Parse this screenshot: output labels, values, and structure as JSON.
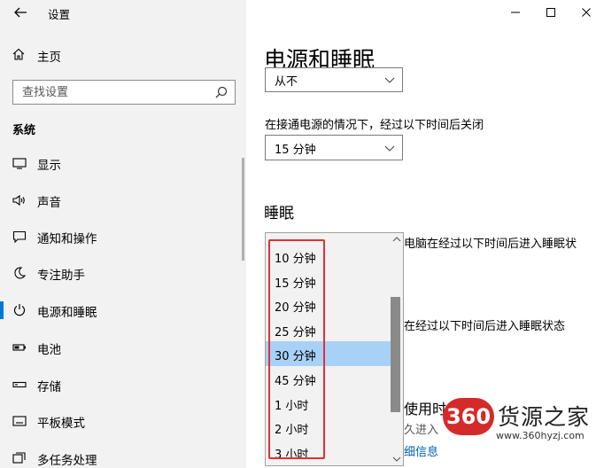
{
  "window": {
    "app_title": "设置",
    "controls": [
      "minimize-icon",
      "maximize-icon",
      "close-icon"
    ]
  },
  "sidebar": {
    "home_label": "主页",
    "search_placeholder": "查找设置",
    "section_title": "系统",
    "items": [
      {
        "label": "显示",
        "icon": "display-icon"
      },
      {
        "label": "声音",
        "icon": "speaker-icon"
      },
      {
        "label": "通知和操作",
        "icon": "notification-icon"
      },
      {
        "label": "专注助手",
        "icon": "moon-icon"
      },
      {
        "label": "电源和睡眠",
        "icon": "power-icon",
        "active": true
      },
      {
        "label": "电池",
        "icon": "battery-icon"
      },
      {
        "label": "存储",
        "icon": "storage-icon"
      },
      {
        "label": "平板模式",
        "icon": "tablet-icon"
      },
      {
        "label": "多任务处理",
        "icon": "multitask-icon"
      }
    ]
  },
  "main": {
    "page_title": "电源和睡眠",
    "screen_battery_value": "从不",
    "screen_plugged_label": "在接通电源的情况下，经过以下时间后关闭",
    "screen_plugged_value": "15 分钟",
    "sleep_heading": "睡眠",
    "sleep_battery_label_partial": "电脑在经过以下时间后进入睡眠状",
    "sleep_plugged_label_partial": "在经过以下时间后进入睡眠状态",
    "energy_partial": "使用时",
    "energy_sub_partial": "久进入",
    "details_link_partial": "细信息"
  },
  "dropdown": {
    "options": [
      "10 分钟",
      "15 分钟",
      "20 分钟",
      "25 分钟",
      "30 分钟",
      "45 分钟",
      "1 小时",
      "2 小时",
      "3 小时"
    ],
    "selected_index": 4
  },
  "watermark": {
    "badge": "360",
    "name": "货源之家",
    "url": "www.360hyzj.com"
  },
  "colors": {
    "sidebar_bg": "#f2f2f2",
    "accent": "#0078d7",
    "selection": "#a8d1f7",
    "highlight_box": "#e03131",
    "link": "#0063b1"
  }
}
